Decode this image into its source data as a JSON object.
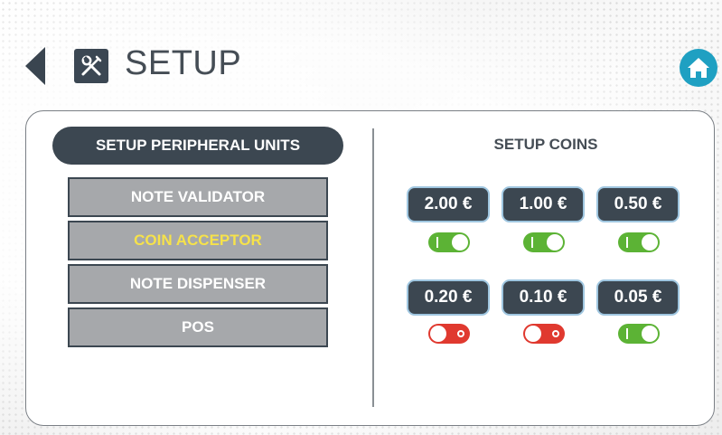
{
  "header": {
    "title": "SETUP"
  },
  "peripherals": {
    "title": "SETUP PERIPHERAL UNITS",
    "items": [
      {
        "label": "NOTE VALIDATOR",
        "active": false
      },
      {
        "label": "COIN ACCEPTOR",
        "active": true
      },
      {
        "label": "NOTE DISPENSER",
        "active": false
      },
      {
        "label": "POS",
        "active": false
      }
    ]
  },
  "coins": {
    "title": "SETUP COINS",
    "items": [
      {
        "label": "2.00 €",
        "enabled": true
      },
      {
        "label": "1.00 €",
        "enabled": true
      },
      {
        "label": "0.50 €",
        "enabled": true
      },
      {
        "label": "0.20 €",
        "enabled": false
      },
      {
        "label": "0.10 €",
        "enabled": false
      },
      {
        "label": "0.05 €",
        "enabled": true
      }
    ]
  },
  "colors": {
    "dark": "#3c4751",
    "accent_home": "#1fa0c2",
    "active_text": "#f6e24a",
    "toggle_on": "#5cb335",
    "toggle_off": "#e0392f"
  },
  "icons": {
    "back": "chevron-left-icon",
    "setup": "wrench-screwdriver-icon",
    "home": "home-icon"
  }
}
